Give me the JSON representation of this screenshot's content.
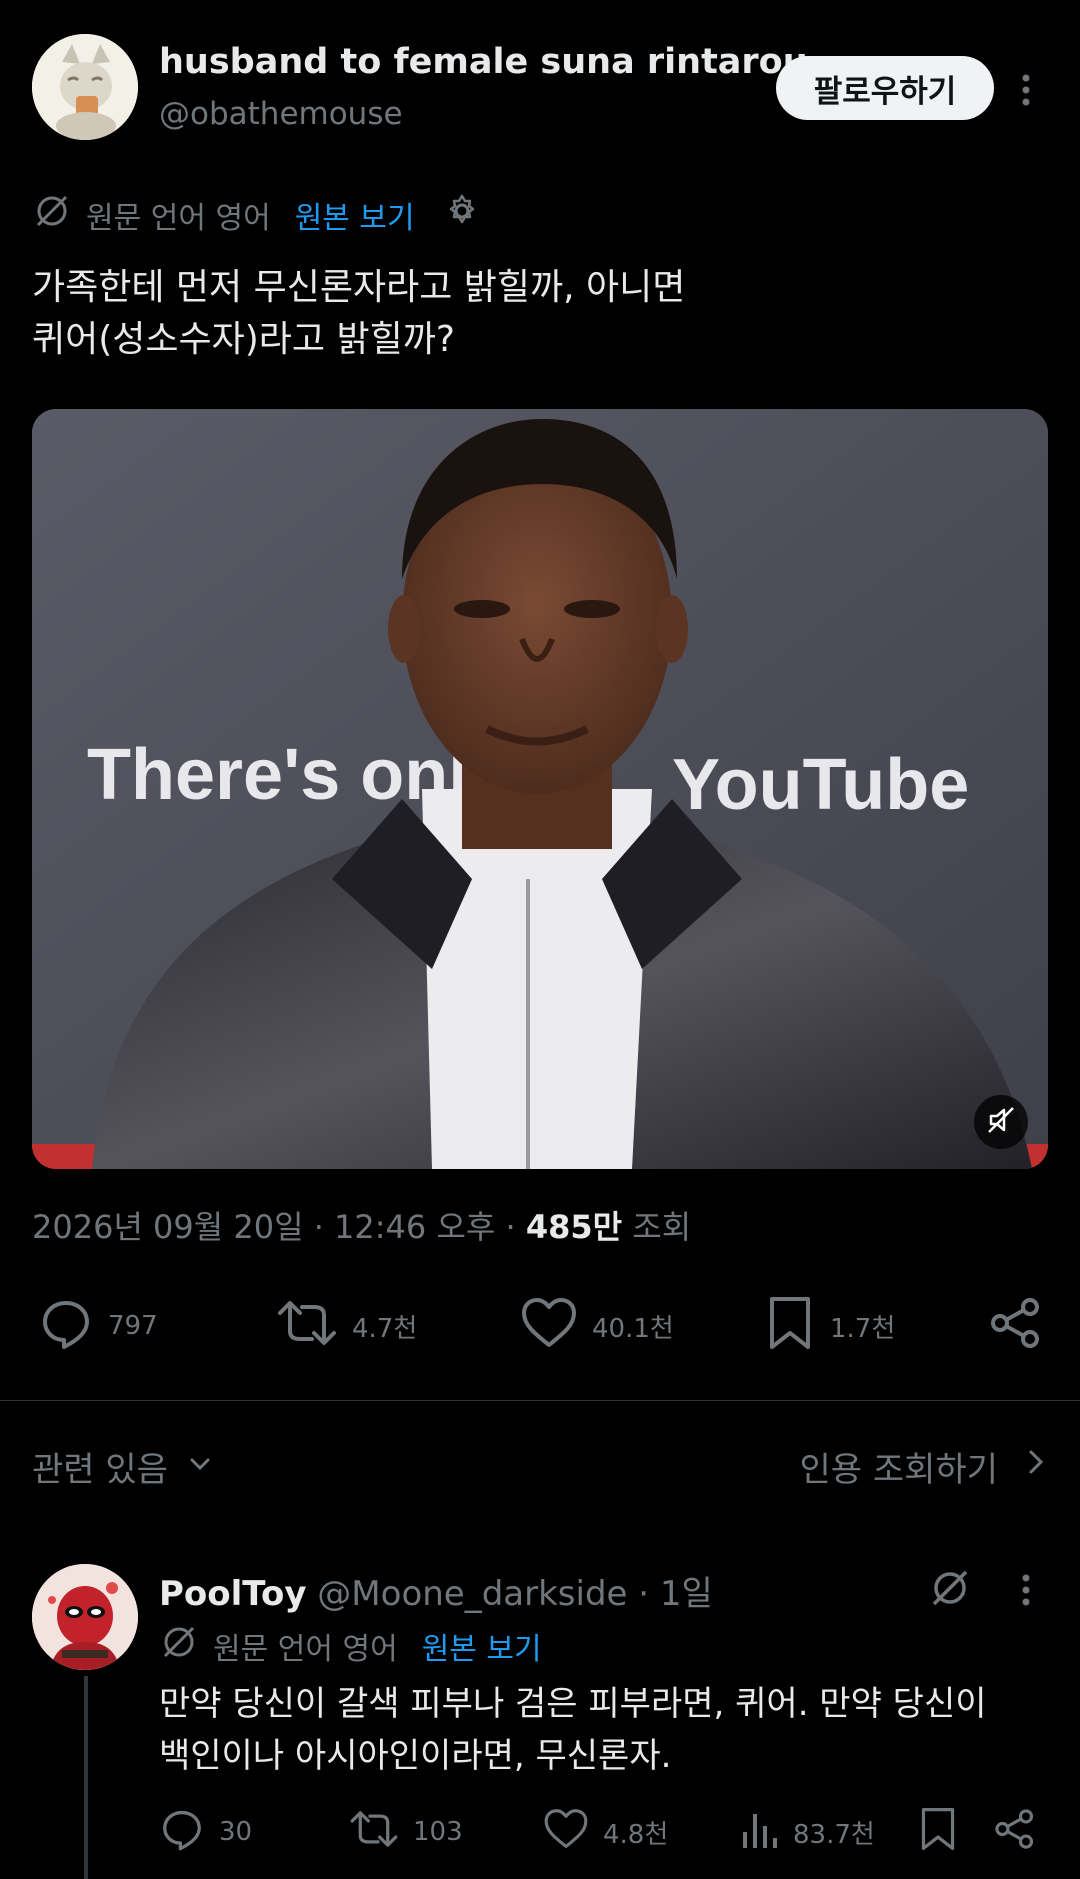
{
  "author": {
    "display_name": "husband to female suna rintarou",
    "handle": "@obathemouse",
    "follow_label": "팔로우하기"
  },
  "translation": {
    "source_label": "원문 언어 영어",
    "view_original": "원본 보기"
  },
  "post": {
    "text": "가족한테 먼저 무신론자라고 밝힐까, 아니면\n퀴어(성소수자)라고 밝힐까?",
    "media": {
      "backdrop_text_left": "There's onl",
      "backdrop_text_right": "YouTube"
    },
    "timestamp": "2026년 09월 20일 · 12:46 오후 · ",
    "views_count": "485만",
    "views_label": " 조회"
  },
  "stats": {
    "replies": "797",
    "reposts": "4.7천",
    "likes": "40.1천",
    "bookmarks": "1.7천"
  },
  "sections": {
    "related": "관련 있음",
    "quotes": "인용 조회하기"
  },
  "reply": {
    "name": "PoolToy",
    "handle": " @Moone_darkside",
    "time": " · 1일",
    "translation_label": "원문 언어 영어",
    "view_original": "원본 보기",
    "text": "만약 당신이 갈색 피부나 검은 피부라면, 퀴어. 만약 당신이\n백인이나 아시아인이라면, 무신론자.",
    "stats": {
      "replies": "30",
      "reposts": "103",
      "likes": "4.8천",
      "views": "83.7천"
    }
  },
  "colors": {
    "background": "#000000",
    "text_primary": "#e7e9ea",
    "text_secondary": "#71767b",
    "link": "#1d9bf0",
    "divider": "#2f3336"
  }
}
